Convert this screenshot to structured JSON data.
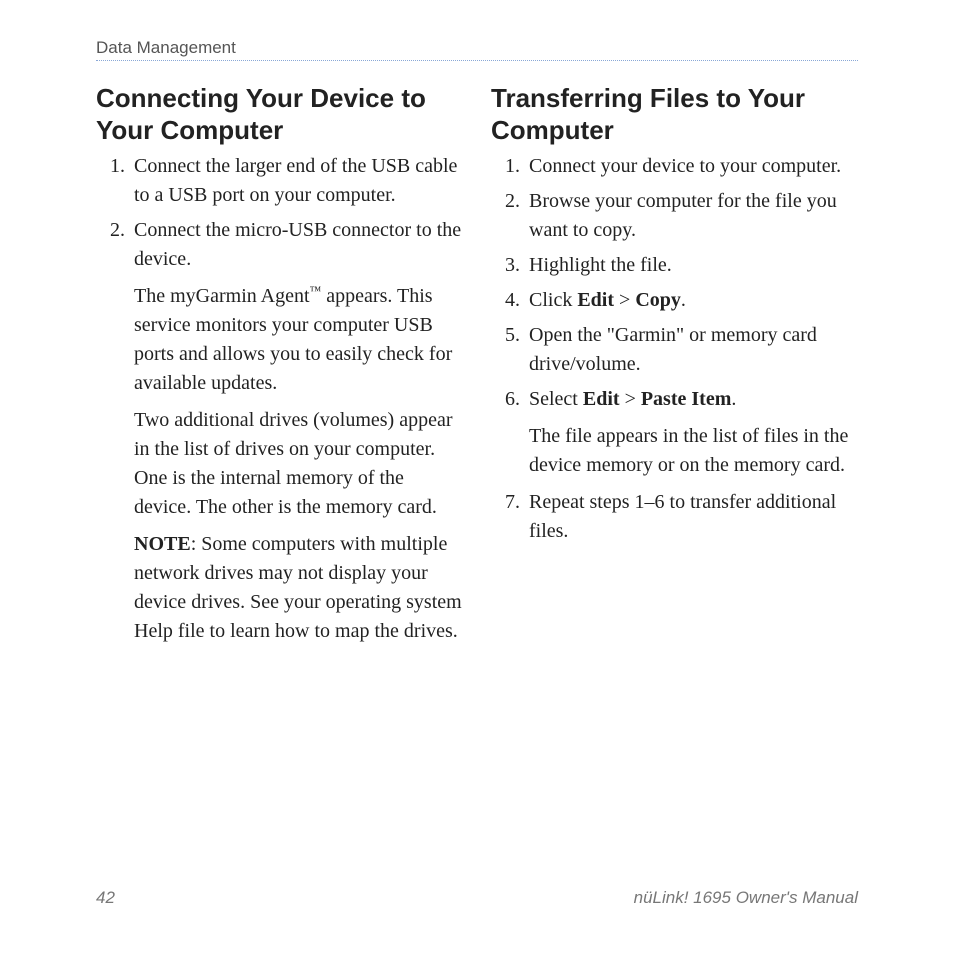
{
  "header": {
    "section": "Data Management"
  },
  "left": {
    "heading": "Connecting Your Device to Your Computer",
    "steps": {
      "1": "Connect the larger end of the USB cable to a USB port on your computer.",
      "2": "Connect the micro-USB connector to the device.",
      "p1a": "The myGarmin Agent",
      "tm": "™",
      "p1b": " appears. This service monitors your computer USB ports and allows you to easily check for available updates.",
      "p2": "Two additional drives (volumes) appear in the list of drives on your computer. One is the internal memory of the device. The other is the memory card.",
      "note_label": "NOTE",
      "note_text": ": Some computers with multiple network drives may not display your device drives. See your operating system Help file to learn how to map the drives."
    }
  },
  "right": {
    "heading": "Transferring Files to Your Computer",
    "steps": {
      "1": "Connect your device to your computer.",
      "2": "Browse your computer for the file you want to copy.",
      "3": "Highlight the file.",
      "4a": "Click ",
      "edit1": "Edit",
      "gt1": " > ",
      "copy": "Copy",
      "4b": ".",
      "5": "Open the \"Garmin\" or memory card drive/volume.",
      "6a": "Select ",
      "edit2": "Edit",
      "gt2": " > ",
      "paste": "Paste Item",
      "6b": ".",
      "p6": "The file appears in the list of files in the device memory or on the memory card.",
      "7": "Repeat steps 1–6 to transfer additional files."
    }
  },
  "footer": {
    "page": "42",
    "manual": "nüLink! 1695 Owner's Manual"
  }
}
